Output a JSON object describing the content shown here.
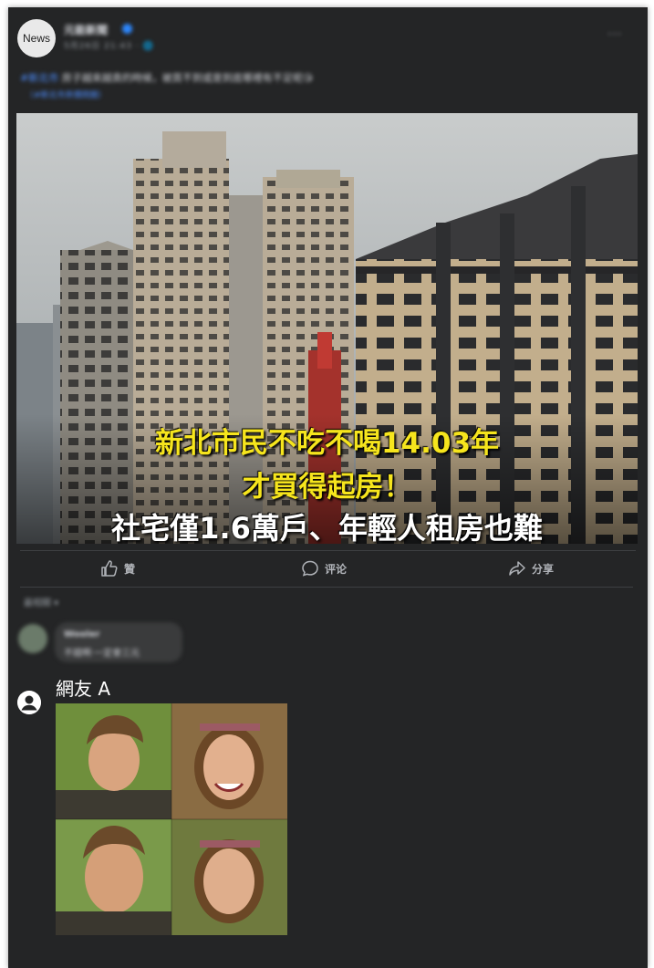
{
  "post": {
    "avatar_label": "News",
    "page_name": "元能新聞",
    "meta": "5月26日 21:43 · 🌐",
    "more": "···",
    "text_tag": "#新北市",
    "text_body": " 房子越來越貴的時候，被買不到或是到底哪裡有不足呢😘",
    "sub_link": "（#新北市房價問題）"
  },
  "image": {
    "headline_1": "新北市民不吃不喝14.03年",
    "headline_2": "才買得起房！",
    "headline_3": "社宅僅1.6萬戶、年輕人租房也難"
  },
  "actions": {
    "like": "贊",
    "comment": "评论",
    "share": "分享"
  },
  "comments": {
    "sort_label": "最相關 ▾",
    "c1_name": "Wooler",
    "c1_text": "不錯啊·一定會三元",
    "c2_name": "網友 A"
  },
  "colors": {
    "card_bg": "#242526",
    "headline_yellow": "#f6e51d",
    "link_blue": "#4d8eff"
  }
}
